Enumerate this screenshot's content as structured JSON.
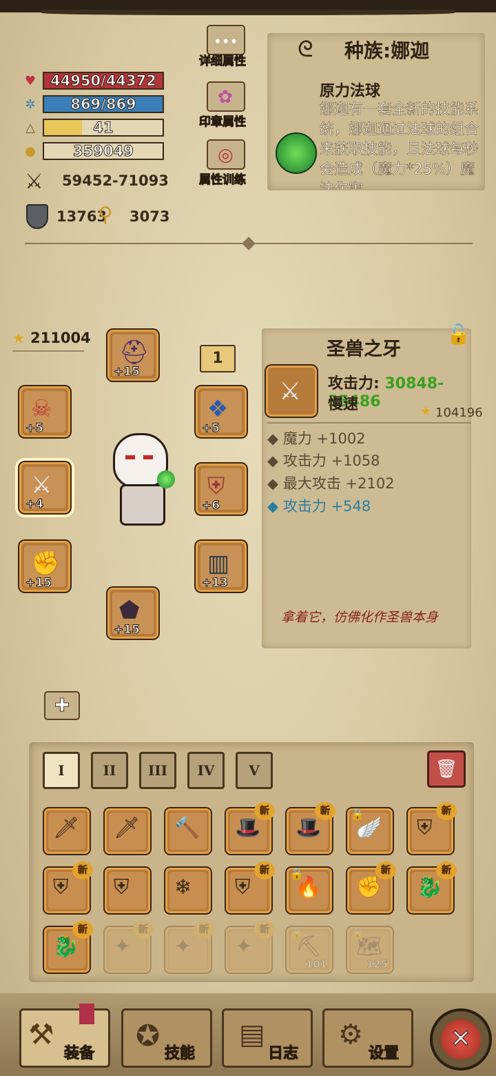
{
  "stats": {
    "hp": "44950/44372",
    "mp": "869/869",
    "exp_level": "41",
    "exp_fill": 0.32,
    "gold": "359049",
    "attack_range": "59452-71093",
    "armor": "13763",
    "magic": "3073"
  },
  "side_buttons": {
    "detail": "详细属性",
    "seal": "印章属性",
    "training": "属性训练"
  },
  "race": {
    "title": "种族:娜迦",
    "skill_name": "原力法球",
    "skill_desc": "娜迦有一套全新的技能系统，娜迦通过法球的组合来获取技能，且法球每秒会造成（魔力*25%）魔法伤害"
  },
  "equipment": {
    "power_score": "211004",
    "page_number": "1",
    "slots": [
      {
        "name": "helmet",
        "level": "+15"
      },
      {
        "name": "offhand",
        "level": "+5"
      },
      {
        "name": "weapon",
        "level": "+4"
      },
      {
        "name": "gloves",
        "level": "+15"
      },
      {
        "name": "amulet",
        "level": "+5"
      },
      {
        "name": "armor",
        "level": "+6"
      },
      {
        "name": "legs",
        "level": "+13"
      },
      {
        "name": "boots",
        "level": "+15"
      }
    ]
  },
  "item_detail": {
    "title": "圣兽之牙",
    "attack_label": "攻击力:",
    "attack_value": "30848-35486",
    "speed": "慢速",
    "score": "104196",
    "bonuses": [
      "魔力 +1002",
      "攻击力 +1058",
      "最大攻击 +2102"
    ],
    "special_bonus": "攻击力 +548",
    "flavor": "拿着它，仿佛化作圣兽本身"
  },
  "inventory_tabs": [
    "I",
    "II",
    "III",
    "IV",
    "V"
  ],
  "inventory": [
    {
      "icon": "sword-icon",
      "new": false
    },
    {
      "icon": "blue-sword-icon",
      "new": false
    },
    {
      "icon": "hammer-icon",
      "new": false
    },
    {
      "icon": "hat-icon",
      "new": true
    },
    {
      "icon": "hat-icon",
      "new": true
    },
    {
      "icon": "wing-armor-icon",
      "new": false,
      "locked": true
    },
    {
      "icon": "dark-armor-icon",
      "new": true
    },
    {
      "icon": "dark-armor-icon",
      "new": true
    },
    {
      "icon": "green-armor-icon",
      "new": false
    },
    {
      "icon": "crystal-armor-icon",
      "new": false
    },
    {
      "icon": "red-armor-icon",
      "new": true
    },
    {
      "icon": "lava-armor-icon",
      "new": false,
      "locked": true
    },
    {
      "icon": "gauntlet-icon",
      "new": true
    },
    {
      "icon": "dragon-armor-icon",
      "new": true
    },
    {
      "icon": "dragon-armor-icon",
      "new": true
    },
    {
      "icon": "faded-item-icon",
      "new": true,
      "faded": true
    },
    {
      "icon": "faded-item-icon",
      "new": true,
      "faded": true
    },
    {
      "icon": "faded-item-icon",
      "new": true,
      "faded": true
    },
    {
      "icon": "pickaxe-icon",
      "count": "101",
      "locked": true,
      "faded": true
    },
    {
      "icon": "map-icon",
      "count": "125",
      "locked": true,
      "faded": true
    }
  ],
  "nav": {
    "equip": "装备",
    "skill": "技能",
    "log": "日志",
    "settings": "设置"
  },
  "colors": {
    "hp_bar": "#b0343a",
    "mp_bar": "#3a7fb8",
    "exp_bar": "#e8c65a",
    "attack_green": "#3aa020",
    "bonus_blue": "#2a7da0"
  }
}
